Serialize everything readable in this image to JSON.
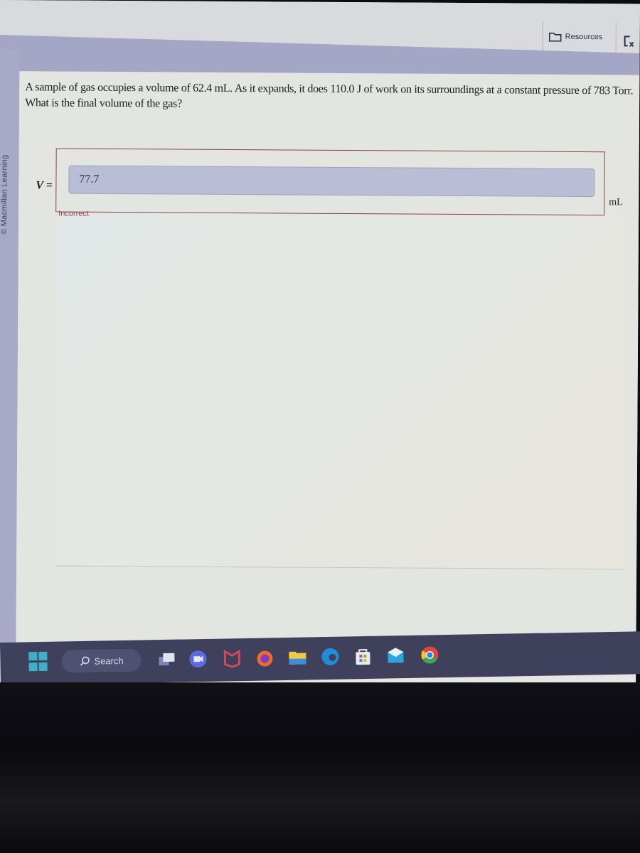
{
  "topbar": {
    "resources_label": "Resources",
    "resources_icon": "folder-icon",
    "exit_icon": "exit-window-icon"
  },
  "sidebar": {
    "copyright": "© Macmillan Learning"
  },
  "question": {
    "text": "A sample of gas occupies a volume of 62.4 mL. As it expands, it does 110.0 J of work on its surroundings at a constant pressure of 783 Torr. What is the final volume of the gas?"
  },
  "answer": {
    "variable_label": "V =",
    "input_value": "77.7",
    "unit": "mL",
    "feedback": "Incorrect",
    "feedback_color": "#8b3f46"
  },
  "taskbar": {
    "search_label": "Search",
    "apps": [
      {
        "name": "start-icon"
      },
      {
        "name": "task-view-icon"
      },
      {
        "name": "teams-chat-icon"
      },
      {
        "name": "mcafee-icon"
      },
      {
        "name": "firefox-icon"
      },
      {
        "name": "file-explorer-icon"
      },
      {
        "name": "edge-icon"
      },
      {
        "name": "microsoft-store-icon"
      },
      {
        "name": "mail-icon"
      },
      {
        "name": "chrome-icon"
      }
    ]
  }
}
